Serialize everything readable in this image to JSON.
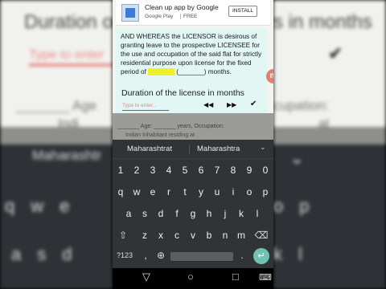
{
  "ad": {
    "title": "Clean up app by Google",
    "store": "Google Play",
    "price": "FREE",
    "install_label": "INSTALL"
  },
  "document": {
    "clause_part1": "AND WHEREAS the LICENSOR is desirous of granting leave to the prospective LICENSEE for the use and occupation of the said flat for strictly residential purpose upon license for the fixed period of",
    "clause_blank_hidden": "xxxxxxxx",
    "clause_part2": "(_______) months.",
    "behind_line1": "_______ Age: _______ years, Occupation:",
    "behind_line2": "Indian Inhabitant residing at"
  },
  "prompt": {
    "label": "Duration of the license in months",
    "placeholder": "Type to enter...",
    "rewind_icon": "◀◀",
    "forward_icon": "▶▶",
    "done_icon": "✔"
  },
  "side_badge": "m",
  "keyboard": {
    "suggestions": [
      "Maharashtrat",
      "Maharashtra"
    ],
    "suggestion_expand": "⌄",
    "row_digits": [
      "1",
      "2",
      "3",
      "4",
      "5",
      "6",
      "7",
      "8",
      "9",
      "0"
    ],
    "row1": [
      "q",
      "w",
      "e",
      "r",
      "t",
      "y",
      "u",
      "i",
      "o",
      "p"
    ],
    "row2": [
      "a",
      "s",
      "d",
      "f",
      "g",
      "h",
      "j",
      "k",
      "l"
    ],
    "row3": [
      "z",
      "x",
      "c",
      "v",
      "b",
      "n",
      "m"
    ],
    "shift_icon": "⇧",
    "backspace_icon": "⌫",
    "symbols_label": "?123",
    "comma_label": ",",
    "globe_icon": "⊕",
    "period_label": ".",
    "enter_icon": "↵"
  },
  "navbar": {
    "back_icon": "▽",
    "home_icon": "○",
    "recents_icon": "□",
    "keyboard_icon": "⌨"
  },
  "background": {
    "left_title": "Duration o",
    "left_placeholder": "Type to enter",
    "left_age": "_______ Age",
    "left_indian": "Indi",
    "left_suggest": "Maharashtr",
    "left_row1": "qwe",
    "left_row2": "asd",
    "right_title": "s in months",
    "right_check": "✔",
    "right_occupation": "cupation:",
    "right_at": "at",
    "right_chev": "⌄",
    "right_row1": "op",
    "right_row2": "kl"
  },
  "colors": {
    "accent": "#6fc3b0",
    "highlight": "#f0f02a",
    "card_bg": "#e2f6f4",
    "underline": "#d83a3a"
  }
}
